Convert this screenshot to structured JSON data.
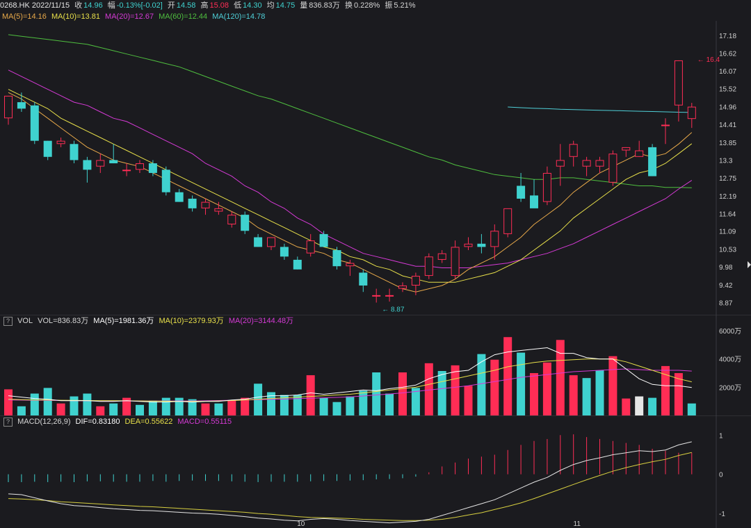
{
  "header": {
    "symbol_date": "0268.HK 2022/11/15",
    "close_label": "收",
    "close": "14.96",
    "change_label": "幅",
    "change": "-0.13%[-0.02]",
    "open_label": "开",
    "open": "14.58",
    "high_label": "高",
    "high": "15.08",
    "low_label": "低",
    "low": "14.30",
    "avg_label": "均",
    "avg": "14.75",
    "volume_label": "量",
    "volume": "836.83万",
    "turnover_label": "换",
    "turnover": "0.228%",
    "amplitude_label": "振",
    "amplitude": "5.21%"
  },
  "ma_legend": [
    {
      "text": "MA(5)=14.16",
      "color": "#e8a94a"
    },
    {
      "text": "MA(10)=13.81",
      "color": "#e8e04a"
    },
    {
      "text": "MA(20)=12.67",
      "color": "#d63ad6"
    },
    {
      "text": "MA(60)=12.44",
      "color": "#4fbf3f"
    },
    {
      "text": "MA(120)=14.78",
      "color": "#4fd0d8"
    }
  ],
  "vol_legend": {
    "help": "?",
    "label": "VOL",
    "items": [
      {
        "text": "VOL=836.83万",
        "color": "#d6d6d6"
      },
      {
        "text": "MA(5)=1981.36万",
        "color": "#ffffff"
      },
      {
        "text": "MA(10)=2379.93万",
        "color": "#e8e04a"
      },
      {
        "text": "MA(20)=3144.48万",
        "color": "#d63ad6"
      }
    ]
  },
  "macd_legend": {
    "help": "?",
    "items": [
      {
        "text": "MACD(12,26,9)",
        "color": "#d6d6d6"
      },
      {
        "text": "DIF=0.83180",
        "color": "#ffffff"
      },
      {
        "text": "DEA=0.55622",
        "color": "#e8e04a"
      },
      {
        "text": "MACD=0.55115",
        "color": "#d63ad6"
      }
    ]
  },
  "colors": {
    "up": "#ff2d55",
    "down": "#3fd2cf",
    "flat": "#e6e6e6",
    "ma5": "#e8a94a",
    "ma10": "#e8e04a",
    "ma20": "#d63ad6",
    "ma60": "#4fbf3f",
    "ma120": "#4fd0d8",
    "dif": "#e6e6e6",
    "dea": "#d8d040"
  },
  "chart_data": [
    {
      "type": "candlestick",
      "ylim": [
        8.6,
        17.5
      ],
      "yticks": [
        "17.18",
        "16.62",
        "16.07",
        "15.52",
        "14.96",
        "14.41",
        "13.85",
        "13.3",
        "12.75",
        "12.19",
        "11.64",
        "11.09",
        "10.53",
        "9.98",
        "9.42",
        "8.87"
      ],
      "xticks": [
        {
          "index": 22,
          "label": "10"
        },
        {
          "index": 43,
          "label": "11"
        }
      ],
      "annotations": [
        {
          "text": "16.4",
          "index": 52,
          "value": 16.4
        },
        {
          "text": "8.87",
          "index": 28,
          "value": 8.87
        }
      ],
      "ohlc": [
        [
          14.6,
          15.3,
          14.4,
          15.3
        ],
        [
          15.1,
          15.4,
          14.8,
          14.9
        ],
        [
          15.0,
          15.1,
          13.8,
          13.9
        ],
        [
          13.9,
          13.9,
          13.3,
          13.4
        ],
        [
          13.8,
          14.0,
          13.7,
          13.9
        ],
        [
          13.8,
          13.9,
          13.2,
          13.3
        ],
        [
          13.3,
          13.4,
          12.6,
          13.0
        ],
        [
          13.1,
          13.5,
          12.9,
          13.3
        ],
        [
          13.3,
          13.8,
          13.2,
          13.2
        ],
        [
          13.0,
          13.2,
          12.8,
          13.0
        ],
        [
          13.0,
          13.3,
          12.9,
          13.2
        ],
        [
          13.2,
          13.3,
          12.8,
          12.9
        ],
        [
          13.0,
          13.1,
          12.2,
          12.3
        ],
        [
          12.3,
          12.4,
          12.0,
          12.0
        ],
        [
          12.1,
          12.2,
          11.7,
          11.8
        ],
        [
          11.8,
          12.1,
          11.6,
          12.0
        ],
        [
          11.7,
          12.0,
          11.6,
          11.8
        ],
        [
          11.3,
          11.7,
          11.2,
          11.6
        ],
        [
          11.6,
          11.7,
          11.0,
          11.1
        ],
        [
          10.9,
          11.0,
          10.6,
          10.6
        ],
        [
          10.6,
          10.9,
          10.5,
          10.9
        ],
        [
          10.6,
          10.7,
          10.2,
          10.3
        ],
        [
          10.2,
          10.3,
          9.9,
          9.9
        ],
        [
          10.4,
          11.0,
          10.3,
          10.8
        ],
        [
          11.0,
          11.1,
          10.6,
          10.6
        ],
        [
          10.5,
          10.6,
          9.9,
          10.0
        ],
        [
          10.0,
          10.2,
          9.7,
          10.1
        ],
        [
          9.8,
          9.9,
          9.2,
          9.4
        ],
        [
          9.1,
          9.3,
          8.87,
          9.1
        ],
        [
          9.1,
          9.3,
          8.9,
          9.1
        ],
        [
          9.3,
          9.5,
          9.2,
          9.4
        ],
        [
          9.4,
          9.8,
          9.1,
          9.7
        ],
        [
          9.7,
          10.4,
          9.6,
          10.3
        ],
        [
          10.2,
          10.5,
          10.1,
          10.4
        ],
        [
          9.7,
          10.8,
          9.6,
          10.6
        ],
        [
          10.6,
          10.9,
          10.5,
          10.7
        ],
        [
          10.7,
          11.0,
          10.4,
          10.6
        ],
        [
          10.6,
          11.3,
          10.2,
          11.1
        ],
        [
          11.0,
          11.5,
          10.9,
          11.8
        ],
        [
          12.5,
          12.9,
          12.0,
          12.1
        ],
        [
          12.2,
          12.7,
          11.9,
          11.8
        ],
        [
          12.0,
          13.1,
          11.9,
          12.9
        ],
        [
          13.1,
          13.8,
          12.5,
          13.3
        ],
        [
          13.4,
          13.9,
          13.1,
          13.8
        ],
        [
          13.1,
          13.4,
          12.8,
          13.3
        ],
        [
          13.1,
          13.4,
          12.9,
          13.3
        ],
        [
          12.6,
          13.6,
          12.5,
          13.5
        ],
        [
          13.6,
          13.7,
          13.4,
          13.7
        ],
        [
          13.4,
          13.9,
          13.4,
          13.6
        ],
        [
          13.7,
          13.8,
          12.8,
          12.8
        ],
        [
          14.4,
          14.6,
          13.8,
          14.4
        ],
        [
          15.0,
          16.4,
          14.5,
          16.4
        ],
        [
          14.58,
          15.08,
          14.3,
          14.96
        ]
      ],
      "ma5": [
        15.4,
        15.2,
        14.9,
        14.6,
        14.3,
        14.0,
        13.7,
        13.5,
        13.3,
        13.2,
        13.1,
        12.9,
        12.7,
        12.5,
        12.3,
        12.1,
        11.9,
        11.7,
        11.5,
        11.2,
        11.0,
        10.8,
        10.6,
        10.5,
        10.4,
        10.2,
        10.1,
        9.9,
        9.7,
        9.5,
        9.3,
        9.2,
        9.3,
        9.4,
        9.6,
        9.9,
        10.1,
        10.3,
        10.6,
        10.9,
        11.3,
        11.6,
        11.9,
        12.3,
        12.6,
        12.9,
        13.1,
        13.3,
        13.5,
        13.4,
        13.5,
        13.8,
        14.16
      ],
      "ma10": [
        15.5,
        15.3,
        15.1,
        14.9,
        14.6,
        14.4,
        14.2,
        14.0,
        13.8,
        13.6,
        13.4,
        13.2,
        13.0,
        12.8,
        12.6,
        12.4,
        12.2,
        12.0,
        11.8,
        11.6,
        11.4,
        11.2,
        11.0,
        10.8,
        10.6,
        10.5,
        10.3,
        10.2,
        10.0,
        9.9,
        9.7,
        9.6,
        9.5,
        9.5,
        9.5,
        9.6,
        9.7,
        9.8,
        10.0,
        10.2,
        10.5,
        10.8,
        11.1,
        11.5,
        11.8,
        12.1,
        12.4,
        12.7,
        12.9,
        13.0,
        13.2,
        13.5,
        13.81
      ],
      "ma20": [
        16.1,
        15.9,
        15.7,
        15.5,
        15.3,
        15.1,
        15.0,
        14.8,
        14.6,
        14.5,
        14.3,
        14.1,
        13.9,
        13.7,
        13.5,
        13.2,
        13.0,
        12.8,
        12.5,
        12.3,
        12.0,
        11.8,
        11.5,
        11.3,
        11.0,
        10.8,
        10.6,
        10.4,
        10.3,
        10.2,
        10.1,
        10.0,
        10.0,
        9.95,
        9.95,
        9.95,
        10.0,
        10.05,
        10.1,
        10.2,
        10.3,
        10.4,
        10.55,
        10.7,
        10.9,
        11.1,
        11.3,
        11.5,
        11.7,
        11.9,
        12.1,
        12.4,
        12.67
      ],
      "ma60": [
        17.2,
        17.15,
        17.1,
        17.05,
        17.0,
        16.95,
        16.9,
        16.8,
        16.7,
        16.6,
        16.5,
        16.4,
        16.3,
        16.2,
        16.05,
        15.9,
        15.75,
        15.6,
        15.45,
        15.3,
        15.2,
        15.05,
        14.9,
        14.75,
        14.6,
        14.45,
        14.3,
        14.15,
        14.0,
        13.85,
        13.7,
        13.55,
        13.4,
        13.3,
        13.15,
        13.05,
        12.95,
        12.85,
        12.8,
        12.75,
        12.7,
        12.7,
        12.75,
        12.75,
        12.7,
        12.65,
        12.6,
        12.55,
        12.5,
        12.5,
        12.45,
        12.45,
        12.44
      ],
      "ma120_start": 38,
      "ma120": [
        14.95,
        14.93,
        14.91,
        14.9,
        14.88,
        14.87,
        14.86,
        14.85,
        14.84,
        14.83,
        14.82,
        14.81,
        14.8,
        14.79,
        14.78
      ]
    },
    {
      "type": "bar",
      "name": "VOL",
      "yticks": [
        "6000万",
        "4000万",
        "2000万"
      ],
      "ylim": [
        0,
        6300
      ],
      "values": [
        1850,
        650,
        1550,
        1950,
        850,
        1350,
        1550,
        650,
        850,
        1250,
        750,
        1050,
        1250,
        1250,
        1150,
        850,
        850,
        1050,
        1250,
        2250,
        1650,
        1450,
        1450,
        2850,
        1250,
        950,
        1350,
        1750,
        3050,
        1550,
        3050,
        1950,
        3700,
        3150,
        3550,
        2100,
        4350,
        3950,
        5550,
        4450,
        3000,
        3750,
        5350,
        2850,
        2650,
        3200,
        4200,
        1200,
        1350,
        1250,
        3500,
        3000,
        850
      ],
      "directions": [
        "u",
        "d",
        "d",
        "d",
        "u",
        "d",
        "d",
        "u",
        "d",
        "u",
        "d",
        "d",
        "d",
        "d",
        "d",
        "u",
        "d",
        "u",
        "u",
        "d",
        "d",
        "d",
        "d",
        "u",
        "d",
        "d",
        "d",
        "d",
        "d",
        "d",
        "u",
        "d",
        "u",
        "d",
        "u",
        "u",
        "d",
        "u",
        "u",
        "d",
        "u",
        "u",
        "u",
        "u",
        "d",
        "d",
        "u",
        "u",
        "f",
        "d",
        "u",
        "u",
        "d"
      ],
      "ma5": [
        1400,
        1300,
        1200,
        1150,
        1050,
        1050,
        1050,
        1000,
        1000,
        1050,
        1000,
        950,
        950,
        1000,
        950,
        1000,
        1000,
        1100,
        1150,
        1300,
        1400,
        1400,
        1450,
        1600,
        1500,
        1600,
        1700,
        1800,
        1750,
        1900,
        2000,
        2150,
        2600,
        2900,
        3100,
        3200,
        3800,
        4300,
        4500,
        4600,
        4700,
        4800,
        4400,
        4400,
        4100,
        4000,
        4000,
        3300,
        2600,
        2200,
        2100,
        2100,
        1981
      ],
      "ma10": [
        1150,
        1120,
        1100,
        1100,
        1080,
        1070,
        1060,
        1050,
        1050,
        1040,
        1030,
        1020,
        1010,
        1000,
        1000,
        1010,
        1030,
        1060,
        1100,
        1150,
        1200,
        1250,
        1300,
        1350,
        1400,
        1450,
        1500,
        1600,
        1700,
        1800,
        1900,
        2000,
        2200,
        2400,
        2600,
        2800,
        3000,
        3200,
        3450,
        3600,
        3750,
        3850,
        3900,
        3950,
        4000,
        4000,
        4000,
        3800,
        3500,
        3200,
        2900,
        2600,
        2380
      ],
      "ma20": [
        1100,
        1090,
        1080,
        1070,
        1060,
        1050,
        1040,
        1030,
        1030,
        1030,
        1030,
        1030,
        1030,
        1030,
        1030,
        1040,
        1060,
        1080,
        1100,
        1120,
        1140,
        1160,
        1190,
        1220,
        1250,
        1280,
        1320,
        1380,
        1450,
        1520,
        1600,
        1700,
        1800,
        1900,
        2000,
        2100,
        2250,
        2400,
        2550,
        2700,
        2800,
        2900,
        3000,
        3100,
        3150,
        3200,
        3250,
        3300,
        3250,
        3200,
        3200,
        3200,
        3144
      ]
    },
    {
      "type": "macd",
      "name": "MACD(12,26,9)",
      "yticks": [
        "1",
        "0",
        "-1"
      ],
      "ylim": [
        -1.3,
        1.2
      ],
      "dif": [
        -0.5,
        -0.52,
        -0.6,
        -0.68,
        -0.75,
        -0.8,
        -0.82,
        -0.85,
        -0.88,
        -0.9,
        -0.92,
        -0.93,
        -0.95,
        -0.97,
        -0.99,
        -1.0,
        -1.02,
        -1.05,
        -1.08,
        -1.12,
        -1.14,
        -1.17,
        -1.19,
        -1.15,
        -1.13,
        -1.15,
        -1.18,
        -1.2,
        -1.22,
        -1.24,
        -1.22,
        -1.2,
        -1.15,
        -1.05,
        -0.95,
        -0.85,
        -0.75,
        -0.65,
        -0.5,
        -0.35,
        -0.2,
        -0.08,
        0.1,
        0.25,
        0.35,
        0.42,
        0.5,
        0.55,
        0.6,
        0.58,
        0.62,
        0.75,
        0.83
      ],
      "dea": [
        -0.62,
        -0.63,
        -0.65,
        -0.67,
        -0.7,
        -0.72,
        -0.74,
        -0.76,
        -0.78,
        -0.8,
        -0.82,
        -0.83,
        -0.85,
        -0.87,
        -0.89,
        -0.91,
        -0.93,
        -0.95,
        -0.97,
        -1.0,
        -1.02,
        -1.05,
        -1.08,
        -1.1,
        -1.11,
        -1.12,
        -1.13,
        -1.15,
        -1.16,
        -1.17,
        -1.18,
        -1.18,
        -1.17,
        -1.15,
        -1.1,
        -1.04,
        -0.98,
        -0.9,
        -0.82,
        -0.73,
        -0.62,
        -0.5,
        -0.38,
        -0.26,
        -0.14,
        -0.03,
        0.08,
        0.17,
        0.25,
        0.32,
        0.38,
        0.48,
        0.556
      ],
      "hist": [
        -0.2,
        -0.2,
        -0.19,
        -0.2,
        -0.19,
        -0.2,
        -0.18,
        -0.18,
        -0.19,
        -0.19,
        -0.19,
        -0.17,
        -0.19,
        -0.17,
        -0.16,
        -0.17,
        -0.17,
        -0.18,
        -0.19,
        -0.2,
        -0.19,
        -0.19,
        -0.19,
        -0.18,
        -0.17,
        -0.17,
        -0.16,
        -0.15,
        -0.13,
        -0.12,
        -0.1,
        -0.06,
        0.05,
        0.2,
        0.3,
        0.4,
        0.45,
        0.5,
        0.62,
        0.75,
        0.85,
        0.9,
        1.0,
        1.02,
        0.95,
        0.9,
        0.85,
        0.8,
        0.75,
        0.65,
        0.6,
        0.55,
        0.551
      ]
    }
  ]
}
